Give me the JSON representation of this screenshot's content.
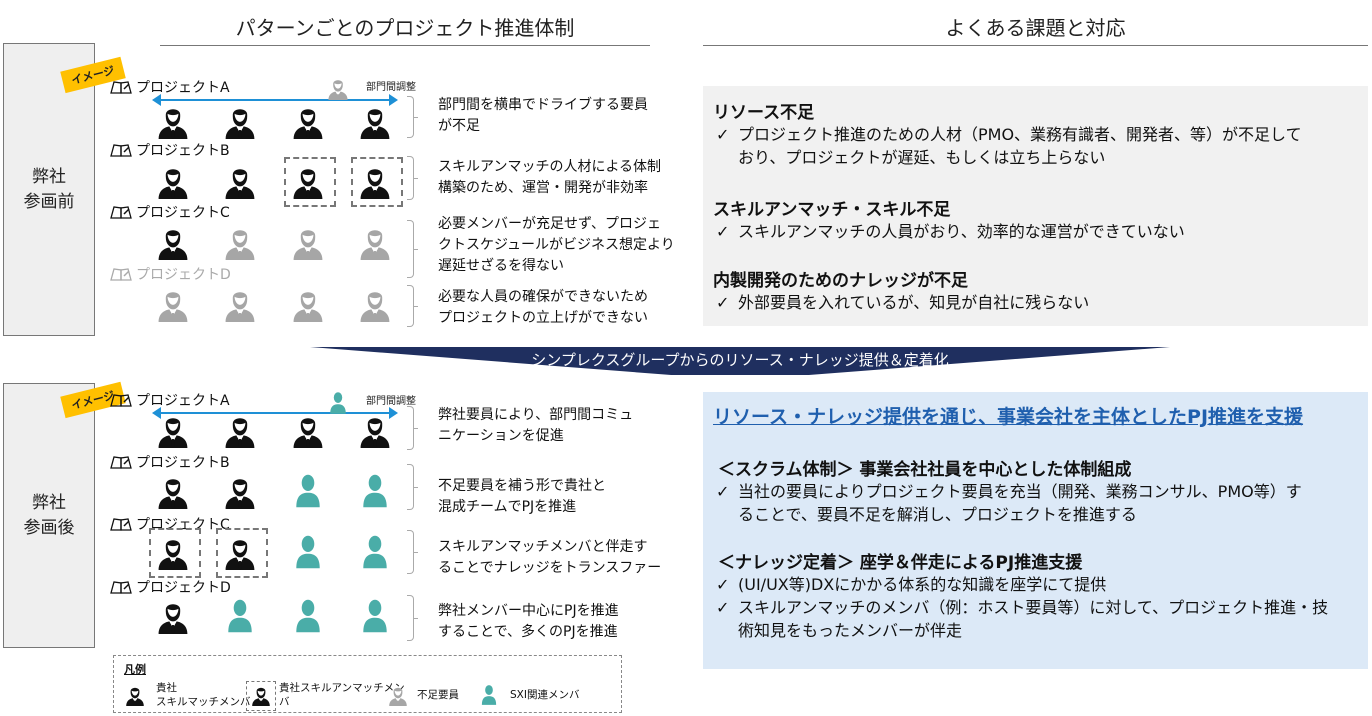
{
  "colors": {
    "accent_blue": "#1e90d6",
    "band_navy": "#1f2f5f",
    "teal": "#4aada8",
    "gray": "#a6a6a6",
    "tag_yellow": "#ffc000",
    "panel_blue": "#dce9f7",
    "panel_gray": "#f1f1f1",
    "heading_blue": "#1f5fae"
  },
  "left_title": "パターンごとのプロジェクト推進体制",
  "right_title": "よくある課題と対応",
  "tag_label": "イメージ",
  "band_text": "シンプレクスグループからのリソース・ナレッジ提供＆定着化",
  "cross_dept_label": "部門間調整",
  "before": {
    "side_label_1": "弊社",
    "side_label_2": "参画前",
    "projects": [
      {
        "name": "プロジェクトA",
        "icon": "notebook-icon",
        "dim": false
      },
      {
        "name": "プロジェクトB",
        "icon": "notebook-icon",
        "dim": false
      },
      {
        "name": "プロジェクトC",
        "icon": "notebook-icon",
        "dim": false
      },
      {
        "name": "プロジェクトD",
        "icon": "notebook-icon",
        "dim": true
      }
    ],
    "rows": [
      [
        "black",
        "black",
        "black",
        "black"
      ],
      [
        "black",
        "black",
        "black-dashed",
        "black-dashed"
      ],
      [
        "black",
        "gray",
        "gray",
        "gray"
      ],
      [
        "gray",
        "gray",
        "gray",
        "gray"
      ]
    ],
    "descriptions": [
      [
        "部門間を横串でドライブする要員",
        "が不足"
      ],
      [
        "スキルアンマッチの人材による体制",
        "構築のため、運営・開発が非効率"
      ],
      [
        "必要メンバーが充足せず、プロジェ",
        "クトスケジュールがビジネス想定より",
        "遅延せざるを得ない"
      ],
      [
        "必要な人員の確保ができないため",
        "プロジェクトの立上げができない"
      ]
    ]
  },
  "after": {
    "side_label_1": "弊社",
    "side_label_2": "参画後",
    "projects": [
      {
        "name": "プロジェクトA",
        "icon": "notebook-icon",
        "dim": false
      },
      {
        "name": "プロジェクトB",
        "icon": "notebook-icon",
        "dim": false
      },
      {
        "name": "プロジェクトC",
        "icon": "notebook-icon",
        "dim": false
      },
      {
        "name": "プロジェクトD",
        "icon": "notebook-icon",
        "dim": false
      }
    ],
    "rows": [
      [
        "black",
        "black",
        "black",
        "black"
      ],
      [
        "black",
        "black",
        "teal",
        "teal"
      ],
      [
        "black-dashed",
        "black-dashed",
        "teal",
        "teal"
      ],
      [
        "black",
        "teal",
        "teal",
        "teal"
      ]
    ],
    "descriptions": [
      [
        "弊社要員により、部門間コミュ",
        "ニケーションを促進"
      ],
      [
        "不足要員を補う形で貴社と",
        "混成チームでPJを推進"
      ],
      [
        "スキルアンマッチメンバと伴走す",
        "ることでナレッジをトランスファー"
      ],
      [
        "弊社メンバー中心にPJを推進",
        "することで、多くのPJを推進"
      ]
    ]
  },
  "issues": {
    "items": [
      {
        "heading": "リソース不足",
        "checks": [
          [
            "プロジェクト推進のための人材（PMO、業務有識者、開発者、等）が不足して",
            "おり、プロジェクトが遅延、もしくは立ち上らない"
          ]
        ]
      },
      {
        "heading": "スキルアンマッチ・スキル不足",
        "checks": [
          [
            "スキルアンマッチの人員がおり、効率的な運営ができていない"
          ]
        ]
      },
      {
        "heading": "内製開発のためのナレッジが不足",
        "checks": [
          [
            "外部要員を入れているが、知見が自社に残らない"
          ]
        ]
      }
    ]
  },
  "support": {
    "title": "リソース・ナレッジ提供を通じ、事業会社を主体としたPJ推進を支援",
    "sections": [
      {
        "heading": "＜スクラム体制＞ 事業会社社員を中心とした体制組成",
        "checks": [
          [
            "当社の要員によりプロジェクト要員を充当（開発、業務コンサル、PMO等）す",
            "ることで、要員不足を解消し、プロジェクトを推進する"
          ]
        ]
      },
      {
        "heading": "＜ナレッジ定着＞ 座学＆伴走によるPJ推進支援",
        "checks": [
          [
            "(UI/UX等)DXにかかる体系的な知識を座学にて提供"
          ],
          [
            "スキルアンマッチのメンバ（例：ホスト要員等）に対して、プロジェクト推進・技",
            "術知見をもったメンバーが伴走"
          ]
        ]
      }
    ]
  },
  "check_mark": "✓",
  "legend": {
    "title": "凡例",
    "items": [
      {
        "icon": "black",
        "lines": [
          "貴社",
          "スキルマッチメンバ"
        ]
      },
      {
        "icon": "black-dashed",
        "lines": [
          "貴社スキルアンマッチメン",
          "バ"
        ]
      },
      {
        "icon": "gray",
        "lines": [
          "不足要員"
        ]
      },
      {
        "icon": "teal",
        "lines": [
          "SXI関連メンバ"
        ]
      }
    ]
  }
}
